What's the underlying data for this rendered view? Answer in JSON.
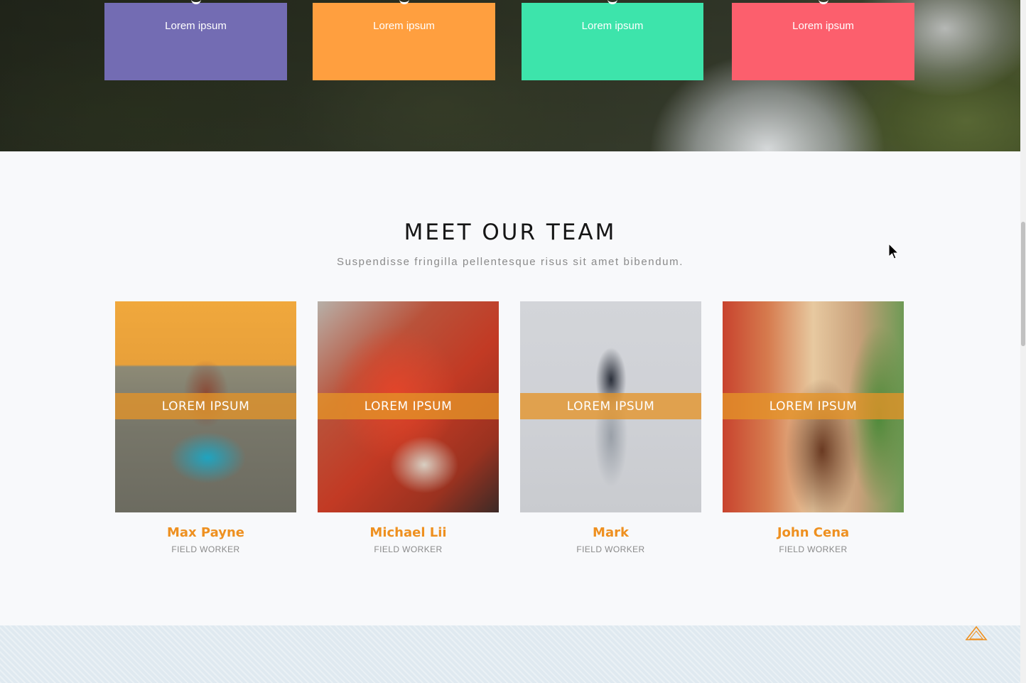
{
  "features": [
    {
      "label": "Lorem ipsum",
      "color": "#736cb3"
    },
    {
      "label": "Lorem ipsum",
      "color": "#ff9f3f"
    },
    {
      "label": "Lorem ipsum",
      "color": "#3de4ab"
    },
    {
      "label": "Lorem ipsum",
      "color": "#fc5f6d"
    }
  ],
  "team": {
    "title": "MEET OUR TEAM",
    "subtitle": "Suspendisse fringilla pellentesque risus sit amet bibendum.",
    "members": [
      {
        "name": "Max Payne",
        "role": "FIELD WORKER",
        "overlay": "LOREM IPSUM"
      },
      {
        "name": "Michael Lii",
        "role": "FIELD WORKER",
        "overlay": "LOREM IPSUM"
      },
      {
        "name": "Mark",
        "role": "FIELD WORKER",
        "overlay": "LOREM IPSUM"
      },
      {
        "name": "John Cena",
        "role": "FIELD WORKER",
        "overlay": "LOREM IPSUM"
      }
    ]
  },
  "colors": {
    "accent": "#ee9020",
    "overlay_band": "#e49428",
    "heading": "#151515",
    "muted": "#8a8a8a"
  },
  "icons": {
    "scroll_top": "triangle-up-icon",
    "cursor": "mouse-pointer-icon"
  }
}
